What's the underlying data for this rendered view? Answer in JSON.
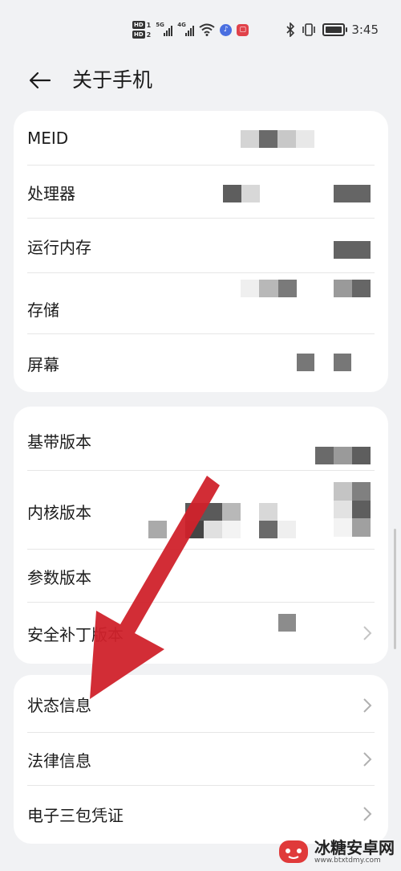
{
  "status_bar": {
    "sim1_label": "HD",
    "sim1_index": "1",
    "sim2_label": "HD",
    "sim2_index": "2",
    "network1": "5G",
    "network2": "4G",
    "time": "3:45",
    "icons": [
      "signal-icon",
      "wifi-icon",
      "music-app-icon",
      "red-app-icon",
      "bluetooth-icon",
      "vibrate-icon",
      "battery-icon"
    ]
  },
  "header": {
    "title": "关于手机",
    "back_icon": "arrow-left-icon"
  },
  "card_device": {
    "items": [
      {
        "label": "MEID",
        "value": "[pixelated]"
      },
      {
        "label": "处理器",
        "value": "[pixelated]"
      },
      {
        "label": "运行内存",
        "value": "[pixelated]"
      },
      {
        "label": "存储",
        "value": "[pixelated]"
      },
      {
        "label": "屏幕",
        "value": "[pixelated]"
      }
    ]
  },
  "card_versions": {
    "items": [
      {
        "label": "基带版本",
        "value": "[pixelated]"
      },
      {
        "label": "内核版本",
        "value": "[pixelated]"
      },
      {
        "label": "参数版本",
        "value": "[pixelated]"
      },
      {
        "label": "安全补丁版本",
        "value": "[pixelated]"
      }
    ]
  },
  "card_info": {
    "items": [
      {
        "label": "状态信息"
      },
      {
        "label": "法律信息"
      },
      {
        "label": "电子三包凭证"
      }
    ]
  },
  "annotation": {
    "color": "#d0222b"
  },
  "watermark": {
    "name": "冰糖安卓网",
    "url": "www.btxtdmy.com"
  }
}
